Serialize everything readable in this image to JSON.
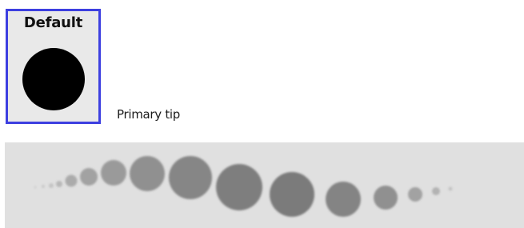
{
  "tip": {
    "title": "Default",
    "selected": true,
    "icon": "circle-tip-icon",
    "fill_color": "#000000",
    "border_color": "#3d3fe0"
  },
  "primary_tip": {
    "label": "Primary tip"
  },
  "stroke_preview": {
    "icon": "stroke-preview-dots",
    "dot_color": "#6d6d6d",
    "background": "#e0e0e0"
  }
}
